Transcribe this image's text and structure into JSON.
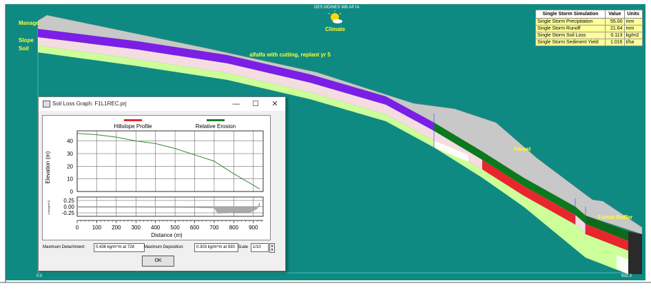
{
  "climate": {
    "station": "DES MOINES WB AP IA",
    "label": "Climate"
  },
  "left_labels": {
    "management": "Manage",
    "slope": "Slope",
    "soil": "Soil"
  },
  "overlay_labels": {
    "management_1": "alfalfa with cutting, replant yr 5",
    "management_2": "Forest",
    "management_3": "Forest Buffer"
  },
  "axis_corners": {
    "bottom_left": "0.0",
    "bottom_right": "932.3"
  },
  "results": {
    "headers": [
      "Single Storm Simulation",
      "Value",
      "Units"
    ],
    "rows": [
      [
        "Single Storm Precipitation",
        "55.00",
        "mm"
      ],
      [
        "Single Storm Runoff",
        "21.64",
        "mm"
      ],
      [
        "Single Storm Soil Loss",
        "0.113",
        "kg/m2"
      ],
      [
        "Single Storm Sediment Yield",
        "1.016",
        "t/ha"
      ]
    ]
  },
  "colors": {
    "background": "#0f8a82",
    "management_1": "#7b1fe6",
    "management_2": "#0c7a1c",
    "soil": "#ccff99",
    "slope": "#f5dce1",
    "top_surface": "#c8c8c8",
    "loss": "#e8262b"
  },
  "dialog": {
    "title": "Soil Loss Graph: F1L1REC.prj",
    "min_button": "—",
    "max_button": "☐",
    "close_button": "✕",
    "legend_profile": "Hillslope Profile",
    "legend_erosion": "Relative Erosion",
    "y_label": "Elevation (m)",
    "y_label_small": "Loss(kg/m^2)",
    "x_label": "Distance (m)",
    "max_detachment_label": "Maximum Detachment:",
    "max_detachment_value": "0.436 kg/m^m at 728",
    "max_deposition_label": "Maximum Deposition:",
    "max_deposition_value": "0.303 kg/m^m at 930",
    "scale_label": "Scale",
    "scale_value": "1/10",
    "ok_label": "OK"
  },
  "chart_data": {
    "type": "line",
    "title": "",
    "xlabel": "Distance (m)",
    "ylabel": "Elevation (m)",
    "xlim": [
      0,
      950
    ],
    "ylim": [
      0,
      48
    ],
    "x_ticks": [
      0,
      100,
      200,
      300,
      400,
      500,
      600,
      700,
      800,
      900
    ],
    "y_ticks": [
      0,
      10,
      20,
      30,
      40
    ],
    "y_ticks_loss": [
      "0.25",
      "0.00",
      "-0.25"
    ],
    "y_tick_labels": [
      "0",
      "10",
      "20",
      "30",
      "40"
    ],
    "x_tick_labels": [
      "0",
      "100",
      "200",
      "300",
      "400",
      "500",
      "600",
      "700",
      "800",
      "900"
    ],
    "series": [
      {
        "name": "Hillslope Profile",
        "x": [
          0,
          100,
          200,
          300,
          400,
          500,
          600,
          700,
          720,
          800,
          900,
          932
        ],
        "y": [
          46,
          45,
          43,
          40,
          38,
          34,
          29,
          24,
          22,
          14,
          5,
          2
        ]
      }
    ]
  }
}
